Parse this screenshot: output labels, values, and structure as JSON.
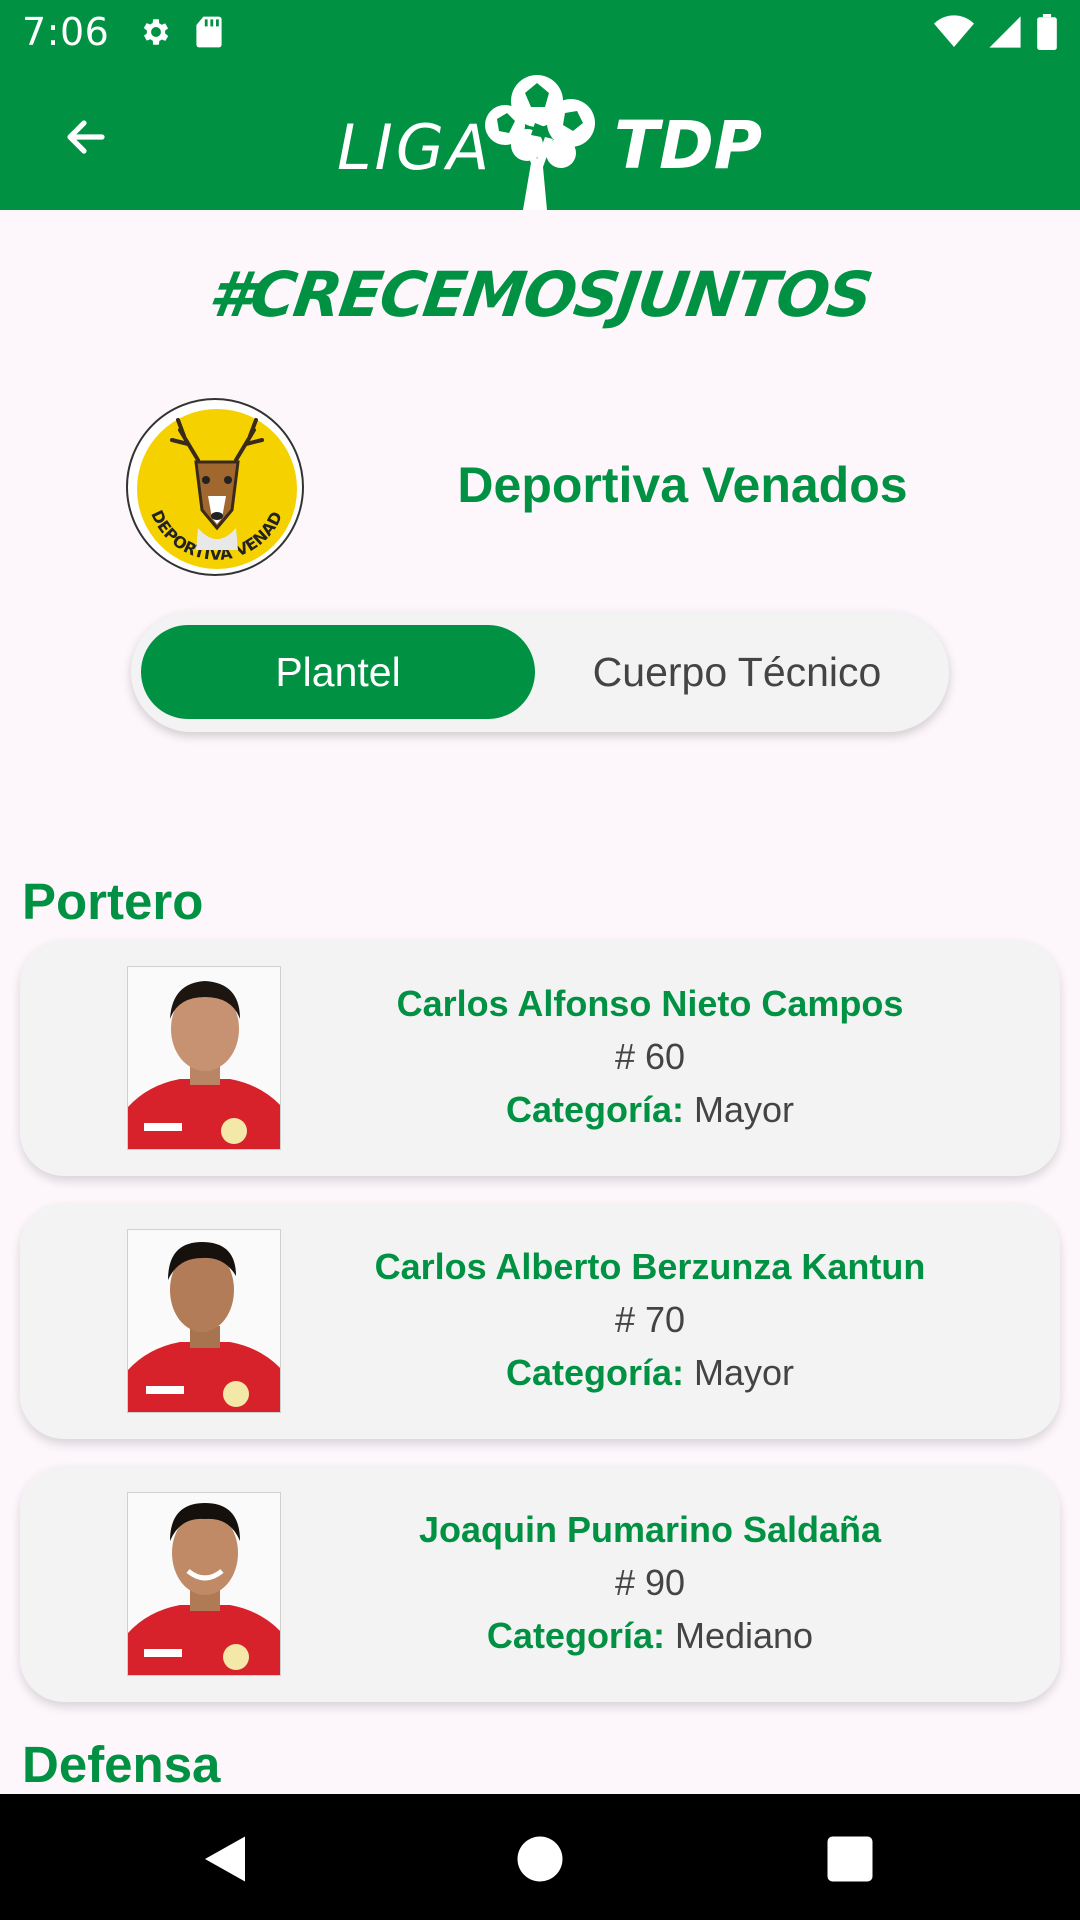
{
  "status_bar": {
    "time": "7:06",
    "left_icons": [
      "gear-icon",
      "sd-card-icon"
    ],
    "right_icons": [
      "wifi-icon",
      "signal-icon",
      "battery-icon"
    ]
  },
  "app_bar": {
    "back_icon": "arrow-left-icon",
    "logo_left": "LIGA",
    "logo_right": "TDP"
  },
  "slogan": "#CRECEMOSJUNTOS",
  "team": {
    "name": "Deportiva Venados",
    "logo_text": "DEPORTIVA VENADOS"
  },
  "tabs": [
    {
      "label": "Plantel",
      "active": true
    },
    {
      "label": "Cuerpo Técnico",
      "active": false
    }
  ],
  "sections": [
    {
      "title": "Portero",
      "players": [
        {
          "name": "Carlos Alfonso Nieto Campos",
          "number": "# 60",
          "category_label": "Categoría:",
          "category": "Mayor"
        },
        {
          "name": "Carlos Alberto Berzunza Kantun",
          "number": "# 70",
          "category_label": "Categoría:",
          "category": "Mayor"
        },
        {
          "name": "Joaquin Pumarino Saldaña",
          "number": "# 90",
          "category_label": "Categoría:",
          "category": "Mediano"
        }
      ]
    },
    {
      "title": "Defensa",
      "players": []
    }
  ],
  "nav_bar": [
    "back-triangle-icon",
    "home-circle-icon",
    "recents-square-icon"
  ],
  "colors": {
    "primary": "#009142",
    "background": "#fdf7fc",
    "card": "#f4f3f4",
    "jersey": "#d8222b"
  }
}
